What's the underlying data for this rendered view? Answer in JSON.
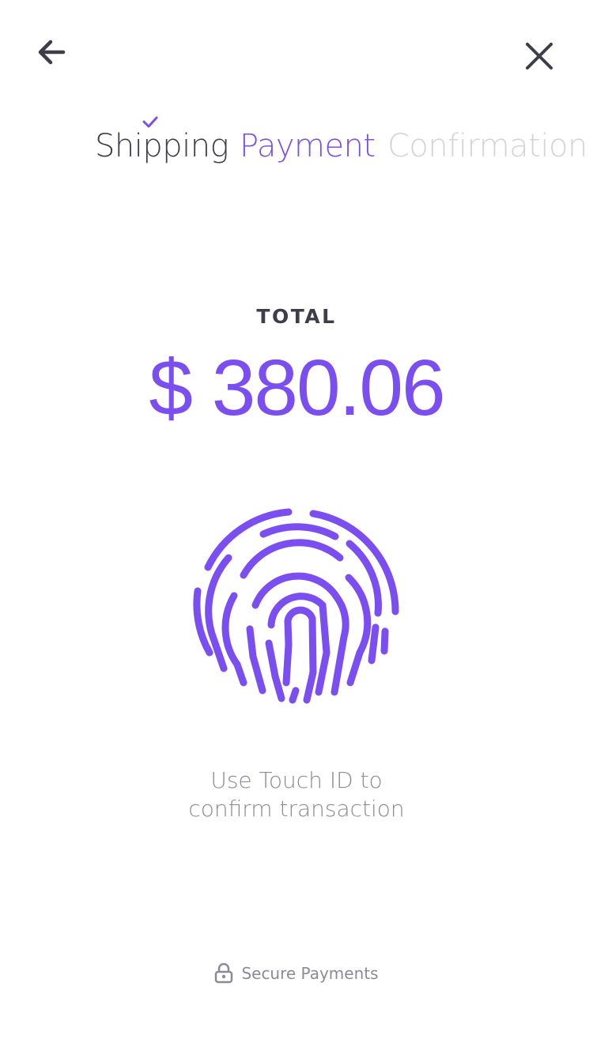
{
  "nav": {
    "back_icon": "arrow-left-icon",
    "close_icon": "close-icon"
  },
  "steps": [
    {
      "label": "Shipping",
      "status": "completed"
    },
    {
      "label": "Payment",
      "status": "active"
    },
    {
      "label": "Confirmation",
      "status": "upcoming"
    }
  ],
  "total": {
    "label": "TOTAL",
    "amount": "$ 380.06"
  },
  "touch_id": {
    "icon": "fingerprint-icon",
    "line1": "Use Touch ID to",
    "line2": "confirm transaction"
  },
  "footer": {
    "icon": "lock-icon",
    "text": "Secure Payments"
  },
  "colors": {
    "accent": "#7b4ef2",
    "text_dark": "#3e3d4a",
    "text_muted": "#8b8a99",
    "text_disabled": "#d4d4d9"
  }
}
